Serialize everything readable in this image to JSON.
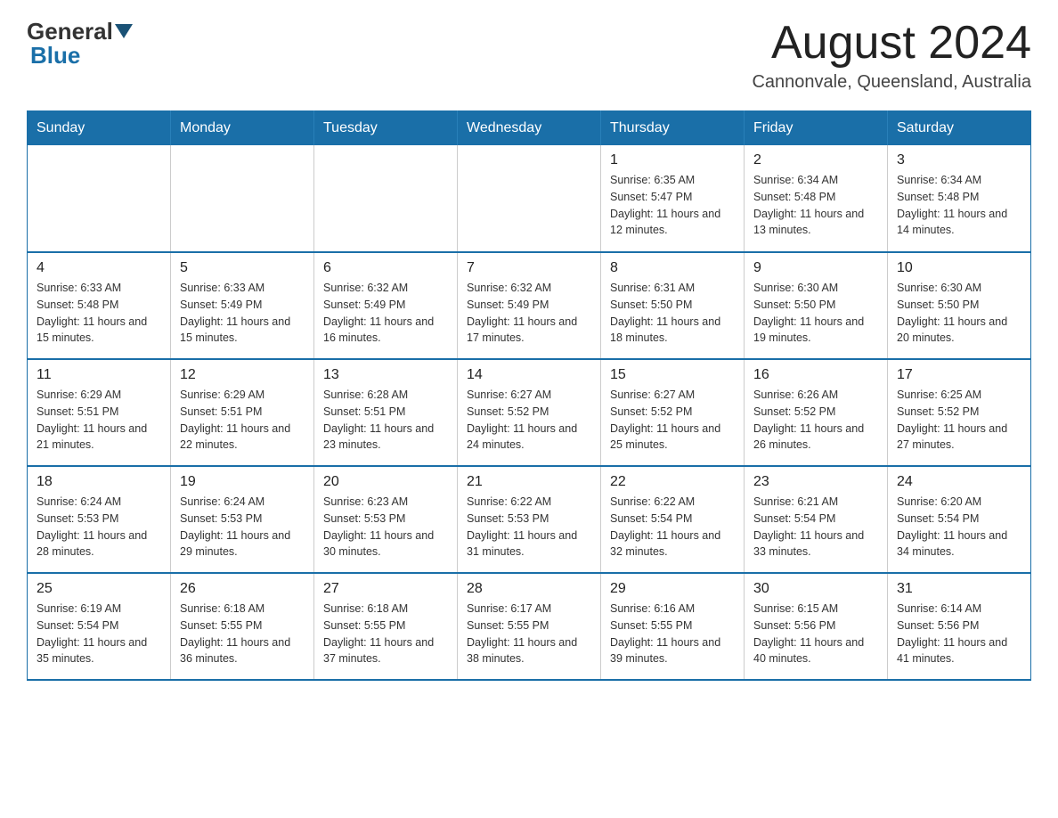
{
  "header": {
    "title": "August 2024",
    "subtitle": "Cannonvale, Queensland, Australia",
    "logo_general": "General",
    "logo_blue": "Blue"
  },
  "days_of_week": [
    "Sunday",
    "Monday",
    "Tuesday",
    "Wednesday",
    "Thursday",
    "Friday",
    "Saturday"
  ],
  "weeks": [
    [
      {
        "day": "",
        "info": ""
      },
      {
        "day": "",
        "info": ""
      },
      {
        "day": "",
        "info": ""
      },
      {
        "day": "",
        "info": ""
      },
      {
        "day": "1",
        "info": "Sunrise: 6:35 AM\nSunset: 5:47 PM\nDaylight: 11 hours and 12 minutes."
      },
      {
        "day": "2",
        "info": "Sunrise: 6:34 AM\nSunset: 5:48 PM\nDaylight: 11 hours and 13 minutes."
      },
      {
        "day": "3",
        "info": "Sunrise: 6:34 AM\nSunset: 5:48 PM\nDaylight: 11 hours and 14 minutes."
      }
    ],
    [
      {
        "day": "4",
        "info": "Sunrise: 6:33 AM\nSunset: 5:48 PM\nDaylight: 11 hours and 15 minutes."
      },
      {
        "day": "5",
        "info": "Sunrise: 6:33 AM\nSunset: 5:49 PM\nDaylight: 11 hours and 15 minutes."
      },
      {
        "day": "6",
        "info": "Sunrise: 6:32 AM\nSunset: 5:49 PM\nDaylight: 11 hours and 16 minutes."
      },
      {
        "day": "7",
        "info": "Sunrise: 6:32 AM\nSunset: 5:49 PM\nDaylight: 11 hours and 17 minutes."
      },
      {
        "day": "8",
        "info": "Sunrise: 6:31 AM\nSunset: 5:50 PM\nDaylight: 11 hours and 18 minutes."
      },
      {
        "day": "9",
        "info": "Sunrise: 6:30 AM\nSunset: 5:50 PM\nDaylight: 11 hours and 19 minutes."
      },
      {
        "day": "10",
        "info": "Sunrise: 6:30 AM\nSunset: 5:50 PM\nDaylight: 11 hours and 20 minutes."
      }
    ],
    [
      {
        "day": "11",
        "info": "Sunrise: 6:29 AM\nSunset: 5:51 PM\nDaylight: 11 hours and 21 minutes."
      },
      {
        "day": "12",
        "info": "Sunrise: 6:29 AM\nSunset: 5:51 PM\nDaylight: 11 hours and 22 minutes."
      },
      {
        "day": "13",
        "info": "Sunrise: 6:28 AM\nSunset: 5:51 PM\nDaylight: 11 hours and 23 minutes."
      },
      {
        "day": "14",
        "info": "Sunrise: 6:27 AM\nSunset: 5:52 PM\nDaylight: 11 hours and 24 minutes."
      },
      {
        "day": "15",
        "info": "Sunrise: 6:27 AM\nSunset: 5:52 PM\nDaylight: 11 hours and 25 minutes."
      },
      {
        "day": "16",
        "info": "Sunrise: 6:26 AM\nSunset: 5:52 PM\nDaylight: 11 hours and 26 minutes."
      },
      {
        "day": "17",
        "info": "Sunrise: 6:25 AM\nSunset: 5:52 PM\nDaylight: 11 hours and 27 minutes."
      }
    ],
    [
      {
        "day": "18",
        "info": "Sunrise: 6:24 AM\nSunset: 5:53 PM\nDaylight: 11 hours and 28 minutes."
      },
      {
        "day": "19",
        "info": "Sunrise: 6:24 AM\nSunset: 5:53 PM\nDaylight: 11 hours and 29 minutes."
      },
      {
        "day": "20",
        "info": "Sunrise: 6:23 AM\nSunset: 5:53 PM\nDaylight: 11 hours and 30 minutes."
      },
      {
        "day": "21",
        "info": "Sunrise: 6:22 AM\nSunset: 5:53 PM\nDaylight: 11 hours and 31 minutes."
      },
      {
        "day": "22",
        "info": "Sunrise: 6:22 AM\nSunset: 5:54 PM\nDaylight: 11 hours and 32 minutes."
      },
      {
        "day": "23",
        "info": "Sunrise: 6:21 AM\nSunset: 5:54 PM\nDaylight: 11 hours and 33 minutes."
      },
      {
        "day": "24",
        "info": "Sunrise: 6:20 AM\nSunset: 5:54 PM\nDaylight: 11 hours and 34 minutes."
      }
    ],
    [
      {
        "day": "25",
        "info": "Sunrise: 6:19 AM\nSunset: 5:54 PM\nDaylight: 11 hours and 35 minutes."
      },
      {
        "day": "26",
        "info": "Sunrise: 6:18 AM\nSunset: 5:55 PM\nDaylight: 11 hours and 36 minutes."
      },
      {
        "day": "27",
        "info": "Sunrise: 6:18 AM\nSunset: 5:55 PM\nDaylight: 11 hours and 37 minutes."
      },
      {
        "day": "28",
        "info": "Sunrise: 6:17 AM\nSunset: 5:55 PM\nDaylight: 11 hours and 38 minutes."
      },
      {
        "day": "29",
        "info": "Sunrise: 6:16 AM\nSunset: 5:55 PM\nDaylight: 11 hours and 39 minutes."
      },
      {
        "day": "30",
        "info": "Sunrise: 6:15 AM\nSunset: 5:56 PM\nDaylight: 11 hours and 40 minutes."
      },
      {
        "day": "31",
        "info": "Sunrise: 6:14 AM\nSunset: 5:56 PM\nDaylight: 11 hours and 41 minutes."
      }
    ]
  ]
}
